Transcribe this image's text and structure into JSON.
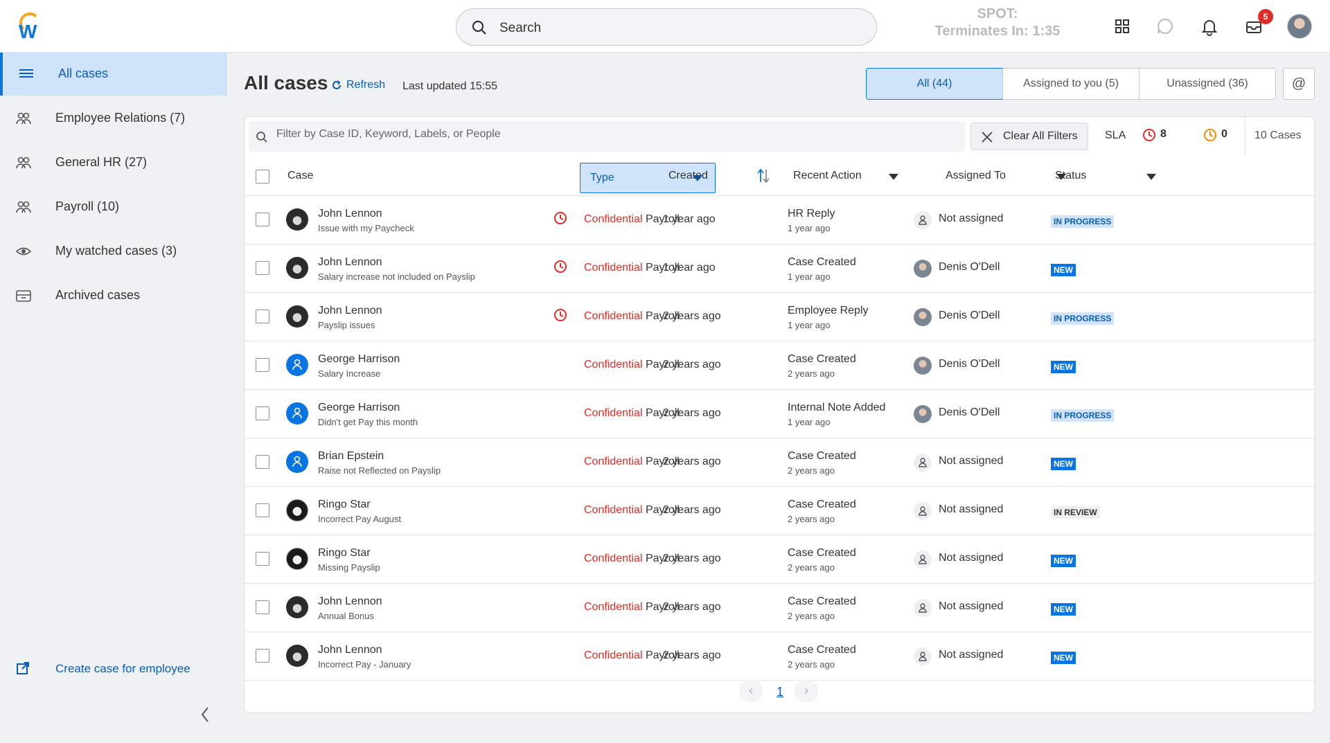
{
  "header": {
    "search_label": "Search",
    "spot_line1": "SPOT:",
    "spot_line2": "Terminates In: 1:35",
    "inbox_badge": "5"
  },
  "sidebar": {
    "items": [
      {
        "label": "All cases",
        "icon": "list-icon",
        "active": true
      },
      {
        "label": "Employee Relations (7)",
        "icon": "people-icon"
      },
      {
        "label": "General HR (27)",
        "icon": "people-icon"
      },
      {
        "label": "Payroll (10)",
        "icon": "people-icon"
      },
      {
        "label": "My watched cases (3)",
        "icon": "eye-icon"
      },
      {
        "label": "Archived cases",
        "icon": "archive-icon"
      }
    ],
    "create_label": "Create case for employee"
  },
  "main": {
    "title": "All cases",
    "refresh_label": "Refresh",
    "last_updated": "Last updated 15:55",
    "segments": [
      "All (44)",
      "Assigned to you (5)",
      "Unassigned (36)"
    ],
    "at_label": "@"
  },
  "toolbar": {
    "filter_placeholder": "Filter by Case ID, Keyword, Labels, or People",
    "clear_label": "Clear All Filters",
    "sla_label": "SLA",
    "sla_red_count": "8",
    "sla_orange_count": "0",
    "case_count": "10 Cases"
  },
  "columns": {
    "case": "Case",
    "type": "Type",
    "created": "Created",
    "recent_action": "Recent Action",
    "assigned_to": "Assigned To",
    "status": "Status"
  },
  "rows": [
    {
      "name": "John Lennon",
      "subject": "Issue with my Paycheck",
      "sla": true,
      "conf": "Confidential",
      "category": "Payroll",
      "created": "1 year ago",
      "action": "HR Reply",
      "action_time": "1 year ago",
      "assignee": "Not assigned",
      "status": "IN PROGRESS"
    },
    {
      "name": "John Lennon",
      "subject": "Salary increase not included on Payslip",
      "sla": true,
      "conf": "Confidential",
      "category": "Payroll",
      "created": "1 year ago",
      "action": "Case Created",
      "action_time": "1 year ago",
      "assignee": "Denis O'Dell",
      "status": "NEW"
    },
    {
      "name": "John Lennon",
      "subject": "Payslip issues",
      "sla": true,
      "conf": "Confidential",
      "category": "Payroll",
      "created": "2 years ago",
      "action": "Employee Reply",
      "action_time": "1 year ago",
      "assignee": "Denis O'Dell",
      "status": "IN PROGRESS"
    },
    {
      "name": "George Harrison",
      "subject": "Salary Increase",
      "sla": false,
      "conf": "Confidential",
      "category": "Payroll",
      "created": "2 years ago",
      "action": "Case Created",
      "action_time": "2 years ago",
      "assignee": "Denis O'Dell",
      "status": "NEW"
    },
    {
      "name": "George Harrison",
      "subject": "Didn't get Pay this month",
      "sla": false,
      "conf": "Confidential",
      "category": "Payroll",
      "created": "2 years ago",
      "action": "Internal Note Added",
      "action_time": "1 year ago",
      "assignee": "Denis O'Dell",
      "status": "IN PROGRESS"
    },
    {
      "name": "Brian Epstein",
      "subject": "Raise not Reflected on Payslip",
      "sla": false,
      "conf": "Confidential",
      "category": "Payroll",
      "created": "2 years ago",
      "action": "Case Created",
      "action_time": "2 years ago",
      "assignee": "Not assigned",
      "status": "NEW"
    },
    {
      "name": "Ringo Star",
      "subject": "Incorrect Pay August",
      "sla": false,
      "conf": "Confidential",
      "category": "Payroll",
      "created": "2 years ago",
      "action": "Case Created",
      "action_time": "2 years ago",
      "assignee": "Not assigned",
      "status": "IN REVIEW"
    },
    {
      "name": "Ringo Star",
      "subject": "Missing Payslip",
      "sla": false,
      "conf": "Confidential",
      "category": "Payroll",
      "created": "2 years ago",
      "action": "Case Created",
      "action_time": "2 years ago",
      "assignee": "Not assigned",
      "status": "NEW"
    },
    {
      "name": "John Lennon",
      "subject": "Annual Bonus",
      "sla": false,
      "conf": "Confidential",
      "category": "Payroll",
      "created": "2 years ago",
      "action": "Case Created",
      "action_time": "2 years ago",
      "assignee": "Not assigned",
      "status": "NEW"
    },
    {
      "name": "John Lennon",
      "subject": "Incorrect Pay - January",
      "sla": false,
      "conf": "Confidential",
      "category": "Payroll",
      "created": "2 years ago",
      "action": "Case Created",
      "action_time": "2 years ago",
      "assignee": "Not assigned",
      "status": "NEW"
    }
  ],
  "pager": {
    "page": "1",
    "prev": "‹",
    "next": "›"
  },
  "colors": {
    "accent": "#0875e1",
    "confidential": "#de2d26",
    "sla_red": "#de2d26",
    "sla_orange": "#f08c00"
  }
}
